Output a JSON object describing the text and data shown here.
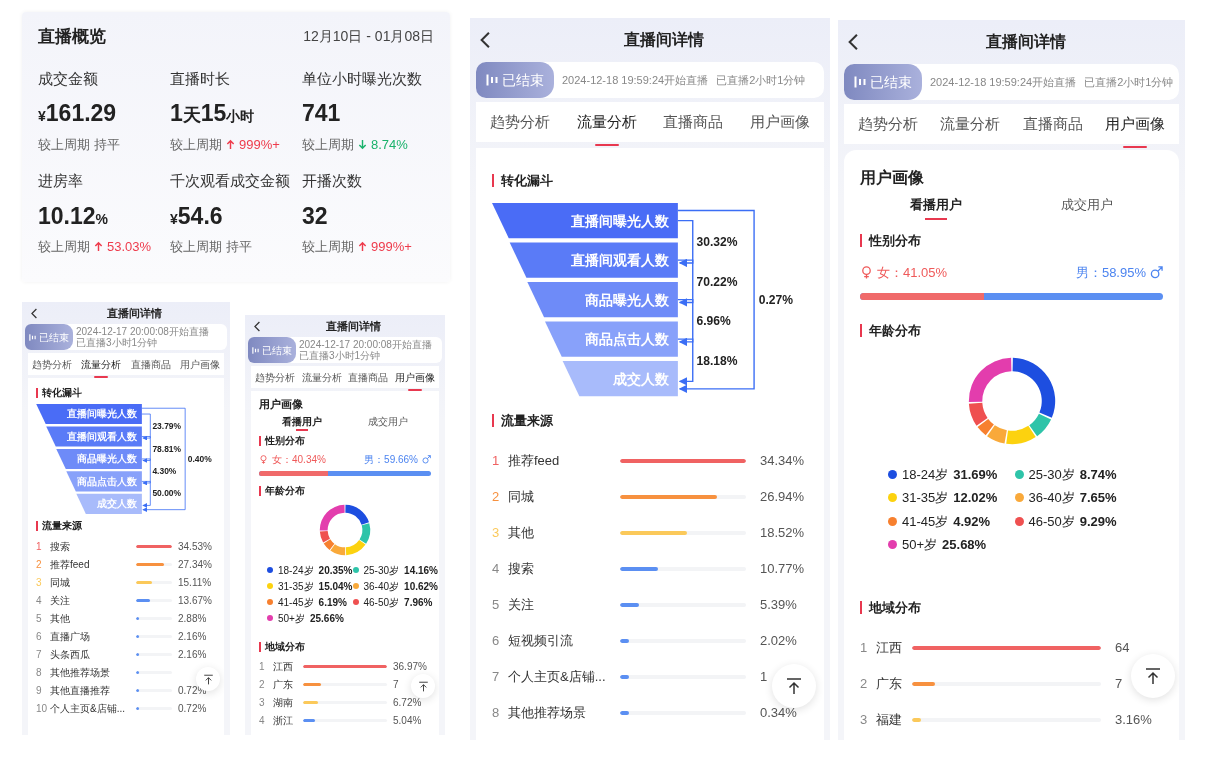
{
  "overview": {
    "title": "直播概览",
    "date_range": "12月10日 - 01月08日",
    "metrics": [
      {
        "label": "成交金额",
        "value": [
          {
            "text": "¥",
            "kind": "unit"
          },
          {
            "text": "161.29",
            "kind": "number"
          }
        ],
        "change": {
          "label": "较上周期",
          "kind": "flat",
          "text": "持平"
        }
      },
      {
        "label": "直播时长",
        "value": [
          {
            "text": "1",
            "kind": "number"
          },
          {
            "text": "天",
            "kind": "large_unit"
          },
          {
            "text": "15",
            "kind": "number"
          },
          {
            "text": "小时",
            "kind": "unit"
          }
        ],
        "change": {
          "label": "较上周期",
          "kind": "up",
          "text": "999%+"
        }
      },
      {
        "label": "单位小时曝光次数",
        "value": [
          {
            "text": "741",
            "kind": "number"
          }
        ],
        "change": {
          "label": "较上周期",
          "kind": "down",
          "text": "8.74%"
        }
      },
      {
        "label": "进房率",
        "value": [
          {
            "text": "10.12",
            "kind": "number"
          },
          {
            "text": "%",
            "kind": "unit"
          }
        ],
        "change": {
          "label": "较上周期",
          "kind": "up",
          "text": "53.03%"
        }
      },
      {
        "label": "千次观看成交金额",
        "value": [
          {
            "text": "¥",
            "kind": "unit"
          },
          {
            "text": "54.6",
            "kind": "number"
          }
        ],
        "change": {
          "label": "较上周期",
          "kind": "flat",
          "text": "持平"
        }
      },
      {
        "label": "开播次数",
        "value": [
          {
            "text": "32",
            "kind": "number"
          }
        ],
        "change": {
          "label": "较上周期",
          "kind": "up",
          "text": "999%+"
        }
      }
    ]
  },
  "screens": [
    {
      "kind": "flow",
      "title": "直播间详情",
      "status": "已结束",
      "start": "2024-12-17 20:00:08开始直播",
      "duration": "已直播3小时1分钟",
      "tabs": [
        {
          "label": "趋势分析",
          "selected": false
        },
        {
          "label": "流量分析",
          "selected": true
        },
        {
          "label": "直播商品",
          "selected": false
        },
        {
          "label": "用户画像",
          "selected": false
        }
      ],
      "funnel": {
        "title": "转化漏斗",
        "stages": [
          "直播间曝光人数",
          "直播间观看人数",
          "商品曝光人数",
          "商品点击人数",
          "成交人数"
        ],
        "steps": [
          "23.79%",
          "78.81%",
          "4.30%",
          "50.00%"
        ],
        "overall": "0.40%"
      },
      "sources": {
        "title": "流量来源",
        "rows": [
          {
            "rank": "1",
            "name": "搜索",
            "level": 1,
            "value": "34.53%",
            "color": "#f06262"
          },
          {
            "rank": "2",
            "name": "推荐feed",
            "level": 0.79,
            "value": "27.34%",
            "color": "#f7913f"
          },
          {
            "rank": "3",
            "name": "同城",
            "level": 0.44,
            "value": "15.11%",
            "color": "#fbc95a"
          },
          {
            "rank": "4",
            "name": "关注",
            "level": 0.4,
            "value": "13.67%",
            "color": "#5b8ff2"
          },
          {
            "rank": "5",
            "name": "其他",
            "level": 0.08,
            "value": "2.88%",
            "color": "#5b8ff2"
          },
          {
            "rank": "6",
            "name": "直播广场",
            "level": 0.07,
            "value": "2.16%",
            "color": "#5b8ff2"
          },
          {
            "rank": "7",
            "name": "头条西瓜",
            "level": 0.07,
            "value": "2.16%",
            "color": "#5b8ff2"
          },
          {
            "rank": "8",
            "name": "其他推荐场景",
            "level": 0.07,
            "color": "#5b8ff2"
          },
          {
            "rank": "9",
            "name": "其他直播推荐",
            "level": 0.07,
            "value": "0.72%",
            "color": "#5b8ff2"
          },
          {
            "rank": "10",
            "name": "个人主页&店铺...",
            "level": 0.07,
            "value": "0.72%",
            "color": "#5b8ff2"
          }
        ]
      }
    },
    {
      "kind": "portrait",
      "title": "直播间详情",
      "status": "已结束",
      "start": "2024-12-17 20:00:08开始直播",
      "duration": "已直播3小时1分钟",
      "tabs": [
        {
          "label": "趋势分析",
          "selected": false
        },
        {
          "label": "流量分析",
          "selected": false
        },
        {
          "label": "直播商品",
          "selected": false
        },
        {
          "label": "用户画像",
          "selected": true
        }
      ],
      "profile": {
        "title": "用户画像",
        "tabs": [
          {
            "label": "看播用户",
            "selected": true
          },
          {
            "label": "成交用户",
            "selected": false
          }
        ]
      },
      "gender": {
        "title": "性别分布",
        "female": "女：40.34%",
        "male": "男：59.66%",
        "level": 0.4
      },
      "age": {
        "title": "年龄分布",
        "groups": [
          {
            "label": "18-24岁",
            "value": "20.35%",
            "color": "#1d4ee0"
          },
          {
            "label": "25-30岁",
            "value": "14.16%",
            "color": "#2ec4a9"
          },
          {
            "label": "31-35岁",
            "value": "15.04%",
            "color": "#fcd20f"
          },
          {
            "label": "36-40岁",
            "value": "10.62%",
            "color": "#f9a93a"
          },
          {
            "label": "41-45岁",
            "value": "6.19%",
            "color": "#f7802f"
          },
          {
            "label": "46-50岁",
            "value": "7.96%",
            "color": "#ef5050"
          },
          {
            "label": "50+岁",
            "value": "25.66%",
            "color": "#e33dad"
          }
        ],
        "chart_data": {
          "type": "donut",
          "values": [
            20.35,
            14.16,
            15.04,
            10.62,
            6.19,
            7.96,
            25.66
          ]
        }
      },
      "regions": {
        "title": "地域分布",
        "rows": [
          {
            "rank": "1",
            "name": "江西",
            "level": 1,
            "value": "36.97%",
            "color": "#f06262"
          },
          {
            "rank": "2",
            "name": "广东",
            "level": 0.21,
            "value": "7",
            "color": "#f7913f"
          },
          {
            "rank": "3",
            "name": "湖南",
            "level": 0.18,
            "value": "6.72%",
            "color": "#fbc95a"
          },
          {
            "rank": "4",
            "name": "浙江",
            "level": 0.14,
            "value": "5.04%",
            "color": "#5b8ff2"
          }
        ]
      }
    },
    {
      "kind": "flow",
      "title": "直播间详情",
      "status": "已结束",
      "start": "2024-12-18 19:59:24开始直播",
      "duration": "已直播2小时1分钟",
      "tabs": [
        {
          "label": "趋势分析",
          "selected": false
        },
        {
          "label": "流量分析",
          "selected": true
        },
        {
          "label": "直播商品",
          "selected": false
        },
        {
          "label": "用户画像",
          "selected": false
        }
      ],
      "funnel": {
        "title": "转化漏斗",
        "stages": [
          "直播间曝光人数",
          "直播间观看人数",
          "商品曝光人数",
          "商品点击人数",
          "成交人数"
        ],
        "steps": [
          "30.32%",
          "70.22%",
          "6.96%",
          "18.18%"
        ],
        "overall": "0.27%"
      },
      "sources": {
        "title": "流量来源",
        "rows": [
          {
            "rank": "1",
            "name": "推荐feed",
            "level": 1,
            "value": "34.34%",
            "color": "#f06262"
          },
          {
            "rank": "2",
            "name": "同城",
            "level": 0.77,
            "value": "26.94%",
            "color": "#f7913f"
          },
          {
            "rank": "3",
            "name": "其他",
            "level": 0.53,
            "value": "18.52%",
            "color": "#fbc95a"
          },
          {
            "rank": "4",
            "name": "搜索",
            "level": 0.3,
            "value": "10.77%",
            "color": "#5b8ff2"
          },
          {
            "rank": "5",
            "name": "关注",
            "level": 0.15,
            "value": "5.39%",
            "color": "#5b8ff2"
          },
          {
            "rank": "6",
            "name": "短视频引流",
            "level": 0.07,
            "value": "2.02%",
            "color": "#5b8ff2"
          },
          {
            "rank": "7",
            "name": "个人主页&店铺...",
            "level": 0.07,
            "value": "1",
            "color": "#5b8ff2"
          },
          {
            "rank": "8",
            "name": "其他推荐场景",
            "level": 0.07,
            "value": "0.34%",
            "color": "#5b8ff2"
          }
        ]
      }
    },
    {
      "kind": "portrait",
      "title": "直播间详情",
      "status": "已结束",
      "start": "2024-12-18 19:59:24开始直播",
      "duration": "已直播2小时1分钟",
      "tabs": [
        {
          "label": "趋势分析",
          "selected": false
        },
        {
          "label": "流量分析",
          "selected": false
        },
        {
          "label": "直播商品",
          "selected": false
        },
        {
          "label": "用户画像",
          "selected": true
        }
      ],
      "profile": {
        "title": "用户画像",
        "tabs": [
          {
            "label": "看播用户",
            "selected": true
          },
          {
            "label": "成交用户",
            "selected": false
          }
        ]
      },
      "gender": {
        "title": "性别分布",
        "female": "女：41.05%",
        "male": "男：58.95%",
        "level": 0.41
      },
      "age": {
        "title": "年龄分布",
        "groups": [
          {
            "label": "18-24岁",
            "value": "31.69%",
            "color": "#1d4ee0"
          },
          {
            "label": "25-30岁",
            "value": "8.74%",
            "color": "#2ec4a9"
          },
          {
            "label": "31-35岁",
            "value": "12.02%",
            "color": "#fcd20f"
          },
          {
            "label": "36-40岁",
            "value": "7.65%",
            "color": "#f9a93a"
          },
          {
            "label": "41-45岁",
            "value": "4.92%",
            "color": "#f7802f"
          },
          {
            "label": "46-50岁",
            "value": "9.29%",
            "color": "#ef5050"
          },
          {
            "label": "50+岁",
            "value": "25.68%",
            "color": "#e33dad"
          }
        ],
        "chart_data": {
          "type": "donut",
          "values": [
            31.69,
            8.74,
            12.02,
            7.65,
            4.92,
            9.29,
            25.68
          ]
        }
      },
      "regions": {
        "title": "地域分布",
        "rows": [
          {
            "rank": "1",
            "name": "江西",
            "level": 1,
            "value": "64",
            "color": "#f06262"
          },
          {
            "rank": "2",
            "name": "广东",
            "level": 0.12,
            "value": "7",
            "color": "#f7913f"
          },
          {
            "rank": "3",
            "name": "福建",
            "level": 0.05,
            "value": "3.16%",
            "color": "#fbc95a"
          }
        ]
      }
    }
  ]
}
